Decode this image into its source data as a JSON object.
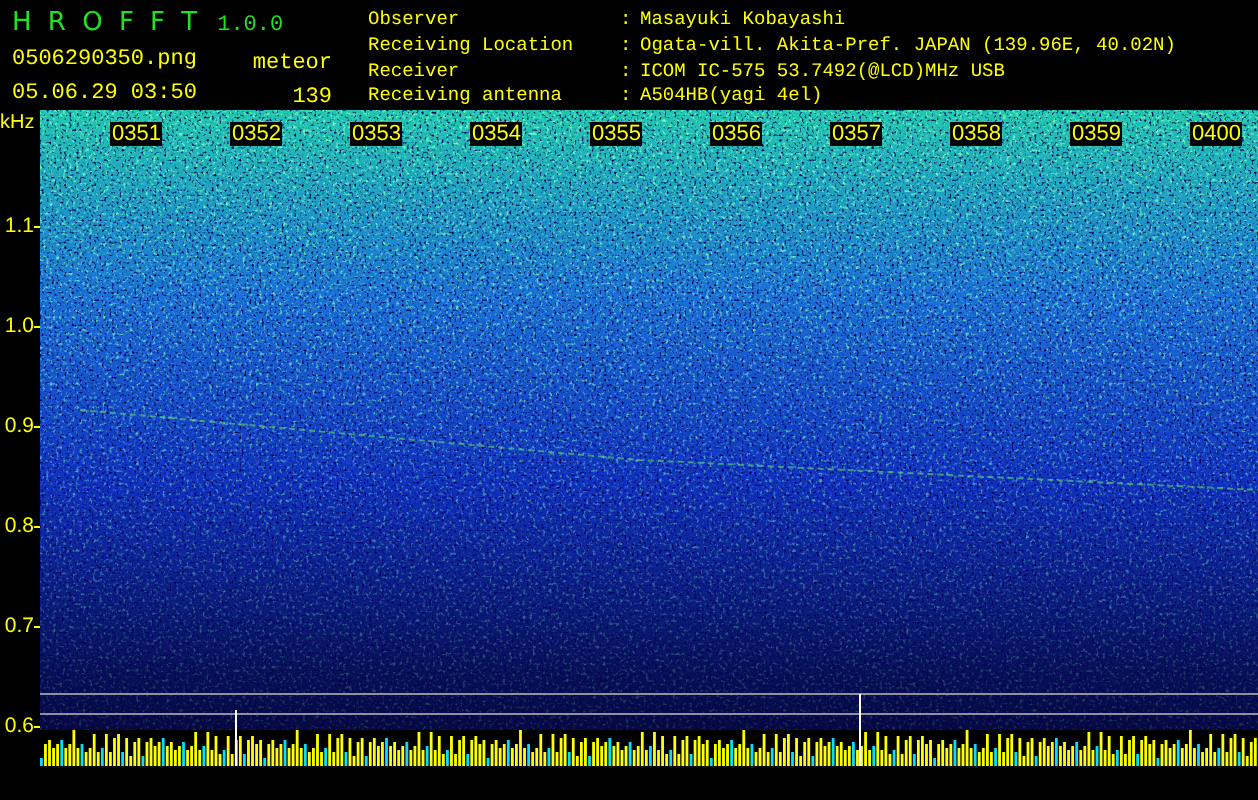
{
  "app": {
    "name": "H R O F F T",
    "version": "1.0.0"
  },
  "file": {
    "name": "0506290350.png",
    "datetime": "05.06.29 03:50"
  },
  "counter": {
    "label": "meteor",
    "value": "139"
  },
  "station": [
    {
      "label": "Observer",
      "separator": ":",
      "value": "Masayuki Kobayashi"
    },
    {
      "label": "Receiving Location",
      "separator": ":",
      "value": "Ogata-vill. Akita-Pref. JAPAN (139.96E, 40.02N)"
    },
    {
      "label": "Receiver",
      "separator": ":",
      "value": "ICOM IC-575 53.7492(@LCD)MHz USB"
    },
    {
      "label": "Receiving antenna",
      "separator": ":",
      "value": "A504HB(yagi 4el)"
    }
  ],
  "spectrogram": {
    "unit": "kHz",
    "frequency_labels": [
      "1.1",
      "1.0",
      "0.9",
      "0.8",
      "0.7",
      "0.6"
    ],
    "time_labels": [
      "0351",
      "0352",
      "0353",
      "0354",
      "0355",
      "0356",
      "0357",
      "0358",
      "0359",
      "0400"
    ]
  }
}
